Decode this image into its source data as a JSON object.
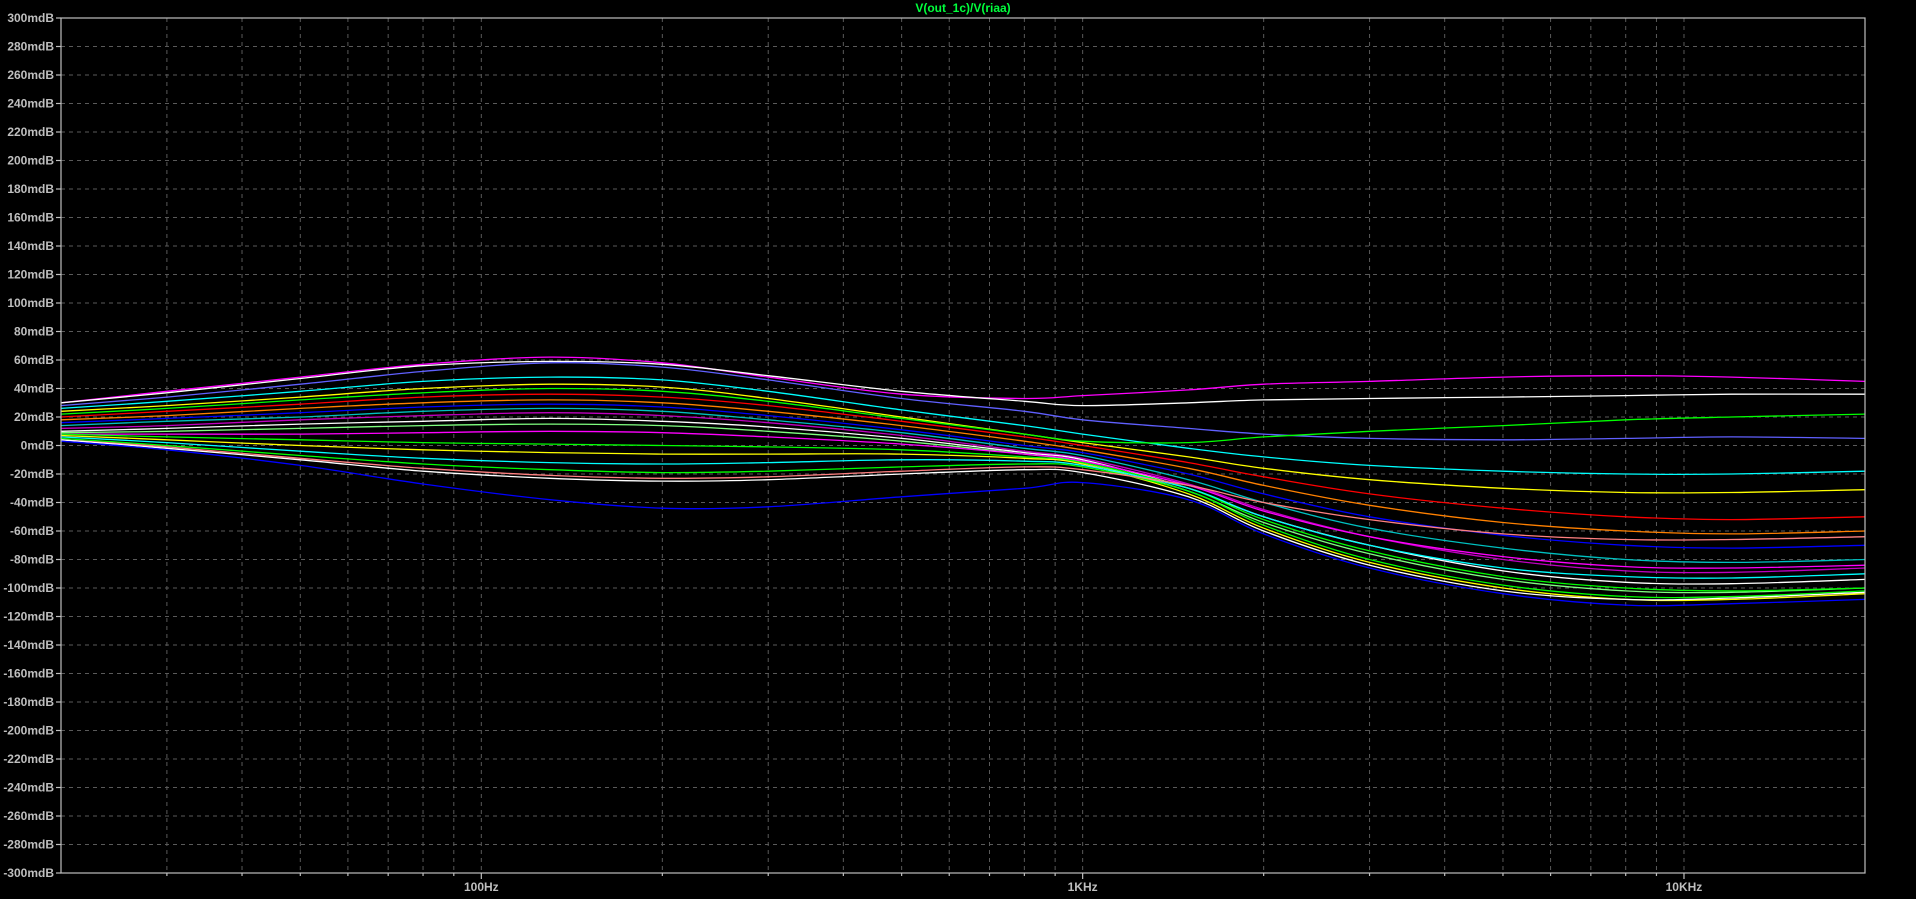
{
  "chart_data": {
    "type": "line",
    "title": "V(out_1c)/V(riaa)",
    "x_scale": "log",
    "xlim": [
      20,
      20000
    ],
    "ylim": [
      -300,
      300
    ],
    "y_unit": "mdB",
    "grid": true,
    "y_ticks": [
      {
        "value": 300,
        "label": "300mdB"
      },
      {
        "value": 280,
        "label": "280mdB"
      },
      {
        "value": 260,
        "label": "260mdB"
      },
      {
        "value": 240,
        "label": "240mdB"
      },
      {
        "value": 220,
        "label": "220mdB"
      },
      {
        "value": 200,
        "label": "200mdB"
      },
      {
        "value": 180,
        "label": "180mdB"
      },
      {
        "value": 160,
        "label": "160mdB"
      },
      {
        "value": 140,
        "label": "140mdB"
      },
      {
        "value": 120,
        "label": "120mdB"
      },
      {
        "value": 100,
        "label": "100mdB"
      },
      {
        "value": 80,
        "label": "80mdB"
      },
      {
        "value": 60,
        "label": "60mdB"
      },
      {
        "value": 40,
        "label": "40mdB"
      },
      {
        "value": 20,
        "label": "20mdB"
      },
      {
        "value": 0,
        "label": "0mdB"
      },
      {
        "value": -20,
        "label": "-20mdB"
      },
      {
        "value": -40,
        "label": "-40mdB"
      },
      {
        "value": -60,
        "label": "-60mdB"
      },
      {
        "value": -80,
        "label": "-80mdB"
      },
      {
        "value": -100,
        "label": "-100mdB"
      },
      {
        "value": -120,
        "label": "-120mdB"
      },
      {
        "value": -140,
        "label": "-140mdB"
      },
      {
        "value": -160,
        "label": "-160mdB"
      },
      {
        "value": -180,
        "label": "-180mdB"
      },
      {
        "value": -200,
        "label": "-200mdB"
      },
      {
        "value": -220,
        "label": "-220mdB"
      },
      {
        "value": -240,
        "label": "-240mdB"
      },
      {
        "value": -260,
        "label": "-260mdB"
      },
      {
        "value": -280,
        "label": "-280mdB"
      },
      {
        "value": -300,
        "label": "-300mdB"
      }
    ],
    "x_major_ticks": [
      {
        "value": 100,
        "label": "100Hz"
      },
      {
        "value": 1000,
        "label": "1KHz"
      },
      {
        "value": 10000,
        "label": "10KHz"
      }
    ],
    "x_minor_gridlines": [
      30,
      40,
      50,
      60,
      70,
      80,
      90,
      200,
      300,
      400,
      500,
      600,
      700,
      800,
      900,
      2000,
      3000,
      4000,
      5000,
      6000,
      7000,
      8000,
      9000
    ],
    "x": [
      20,
      30,
      50,
      80,
      130,
      200,
      300,
      500,
      800,
      1000,
      1500,
      2000,
      3000,
      5000,
      8000,
      12000,
      20000
    ],
    "series": [
      {
        "color": "#ff00ff",
        "values": [
          30,
          38,
          48,
          57,
          62,
          58,
          48,
          36,
          33,
          35,
          39,
          43,
          45,
          48,
          49,
          48,
          45
        ]
      },
      {
        "color": "#ffffff",
        "values": [
          30,
          37,
          47,
          56,
          59,
          57,
          49,
          38,
          31,
          28,
          30,
          32,
          33,
          34,
          35,
          36,
          36
        ]
      },
      {
        "color": "#6060ff",
        "values": [
          28,
          34,
          43,
          52,
          58,
          55,
          46,
          33,
          24,
          18,
          12,
          8,
          5,
          4,
          5,
          6,
          5
        ]
      },
      {
        "color": "#00ffff",
        "values": [
          26,
          31,
          38,
          45,
          48,
          46,
          38,
          25,
          14,
          8,
          -2,
          -8,
          -14,
          -18,
          -20,
          -20,
          -18
        ]
      },
      {
        "color": "#ffff00",
        "values": [
          24,
          28,
          34,
          40,
          43,
          41,
          33,
          20,
          8,
          2,
          -8,
          -16,
          -24,
          -30,
          -33,
          -33,
          -31
        ]
      },
      {
        "color": "#00ff00",
        "values": [
          22,
          26,
          32,
          37,
          40,
          38,
          31,
          19,
          8,
          3,
          2,
          6,
          10,
          14,
          18,
          20,
          22
        ]
      },
      {
        "color": "#ff0000",
        "values": [
          20,
          24,
          29,
          34,
          36,
          34,
          28,
          17,
          6,
          0,
          -12,
          -22,
          -34,
          -44,
          -50,
          -52,
          -50
        ]
      },
      {
        "color": "#ff8000",
        "values": [
          18,
          21,
          26,
          30,
          32,
          30,
          24,
          14,
          3,
          -3,
          -16,
          -28,
          -42,
          -54,
          -60,
          -62,
          -60
        ]
      },
      {
        "color": "#0000ff",
        "values": [
          16,
          19,
          23,
          27,
          29,
          27,
          21,
          11,
          0,
          -5,
          -20,
          -34,
          -50,
          -63,
          -70,
          -72,
          -70
        ]
      },
      {
        "color": "#00c0c0",
        "values": [
          14,
          17,
          20,
          24,
          26,
          24,
          18,
          9,
          -2,
          -7,
          -24,
          -40,
          -58,
          -72,
          -80,
          -82,
          -80
        ]
      },
      {
        "color": "#c000c0",
        "values": [
          12,
          14,
          18,
          21,
          23,
          21,
          16,
          7,
          -4,
          -9,
          -27,
          -45,
          -64,
          -80,
          -88,
          -89,
          -86
        ]
      },
      {
        "color": "#ffffff",
        "values": [
          10,
          12,
          15,
          17,
          19,
          17,
          13,
          5,
          -5,
          -10,
          -30,
          -50,
          -70,
          -88,
          -96,
          -97,
          -94
        ]
      },
      {
        "color": "#80ff80",
        "values": [
          9,
          10,
          12,
          14,
          15,
          14,
          10,
          3,
          -6,
          -12,
          -32,
          -54,
          -76,
          -94,
          -102,
          -103,
          -100
        ]
      },
      {
        "color": "#ff00ff",
        "values": [
          8,
          8,
          8,
          9,
          10,
          9,
          6,
          1,
          -6,
          -11,
          -28,
          -46,
          -64,
          -78,
          -85,
          -86,
          -84
        ]
      },
      {
        "color": "#00ff00",
        "values": [
          8,
          6,
          4,
          2,
          1,
          0,
          -1,
          -3,
          -8,
          -12,
          -30,
          -52,
          -74,
          -92,
          -100,
          -102,
          -100
        ]
      },
      {
        "color": "#ffff00",
        "values": [
          7,
          4,
          0,
          -3,
          -5,
          -6,
          -6,
          -6,
          -9,
          -13,
          -34,
          -58,
          -82,
          -100,
          -108,
          -108,
          -104
        ]
      },
      {
        "color": "#00ffff",
        "values": [
          6,
          2,
          -4,
          -9,
          -12,
          -13,
          -12,
          -10,
          -11,
          -14,
          -30,
          -50,
          -70,
          -86,
          -92,
          -93,
          -90
        ]
      },
      {
        "color": "#00ff00",
        "values": [
          5,
          0,
          -7,
          -13,
          -17,
          -19,
          -18,
          -15,
          -13,
          -15,
          -32,
          -56,
          -80,
          -98,
          -106,
          -106,
          -102
        ]
      },
      {
        "color": "#ff8080",
        "values": [
          4,
          -1,
          -9,
          -16,
          -21,
          -23,
          -22,
          -18,
          -15,
          -17,
          -28,
          -40,
          -52,
          -62,
          -66,
          -66,
          -64
        ]
      },
      {
        "color": "#ffffff",
        "values": [
          4,
          -2,
          -10,
          -18,
          -23,
          -25,
          -24,
          -20,
          -17,
          -19,
          -36,
          -60,
          -84,
          -102,
          -108,
          -107,
          -103
        ]
      },
      {
        "color": "#0000ff",
        "values": [
          3,
          -3,
          -14,
          -27,
          -38,
          -44,
          -43,
          -36,
          -30,
          -26,
          -38,
          -62,
          -86,
          -104,
          -112,
          -111,
          -108
        ]
      }
    ]
  }
}
